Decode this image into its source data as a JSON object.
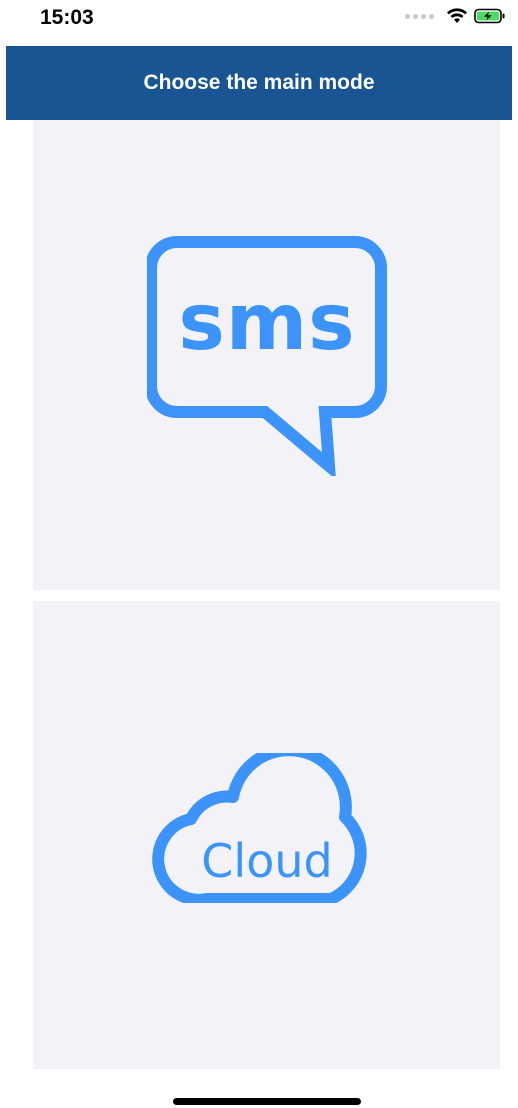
{
  "status_bar": {
    "time": "15:03",
    "icons": [
      "signal-dots-icon",
      "wifi-icon",
      "battery-charging-icon"
    ]
  },
  "header": {
    "title": "Choose the main mode",
    "background_color": "#185592"
  },
  "modes": [
    {
      "id": "sms",
      "label": "sms",
      "icon": "sms-speech-bubble-icon"
    },
    {
      "id": "cloud",
      "label": "Cloud",
      "icon": "cloud-icon"
    }
  ],
  "colors": {
    "accent": "#3c93fa",
    "panel_background": "#f2f2f7",
    "battery_fill": "#4cd964"
  }
}
